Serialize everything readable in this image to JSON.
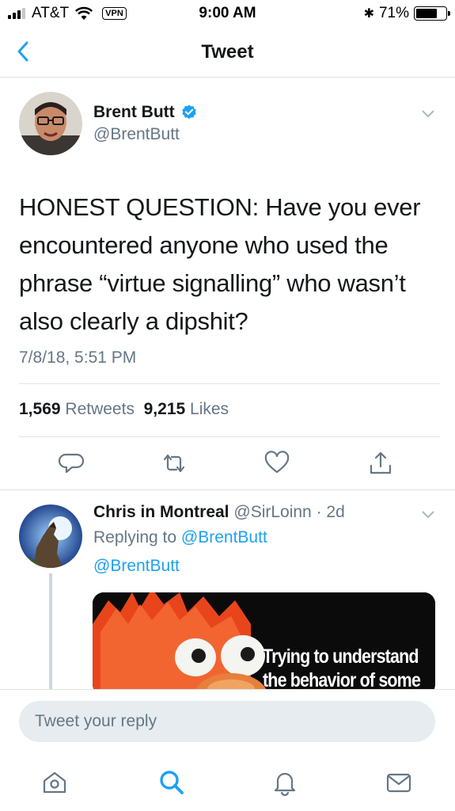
{
  "status_bar": {
    "carrier": "AT&T",
    "vpn": "VPN",
    "time": "9:00 AM",
    "bluetooth": "✱",
    "battery": "71%",
    "battery_level": 0.71
  },
  "nav": {
    "title": "Tweet",
    "back_icon": "chevron-left-icon"
  },
  "tweet": {
    "author_name": "Brent Butt",
    "author_handle": "@BrentButt",
    "text": "HONEST QUESTION: Have you ever encountered anyone who used the phrase “virtue signalling” who wasn’t also clearly a dipshit?",
    "timestamp": "7/8/18, 5:51 PM",
    "retweet_count": "1,569",
    "retweet_label": "Retweets",
    "like_count": "9,215",
    "like_label": "Likes",
    "actions": [
      "reply-icon",
      "retweet-icon",
      "like-icon",
      "share-icon"
    ]
  },
  "reply": {
    "author_name": "Chris in Montreal",
    "author_handle": "@SirLoinn",
    "time": "· 2d",
    "replying_prefix": "Replying to",
    "replying_to_1": "@BrentButt",
    "replying_to_2": "@BrentButt",
    "media_caption_line1": "Trying to understand",
    "media_caption_line2": "the behavior of some"
  },
  "reply_bar": {
    "placeholder": "Tweet your reply"
  },
  "tab_bar": [
    "home-icon",
    "search-icon",
    "notifications-icon",
    "messages-icon"
  ],
  "colors": {
    "accent": "#1da1f2",
    "secondary_text": "#657786",
    "divider": "#dfe3e6"
  }
}
